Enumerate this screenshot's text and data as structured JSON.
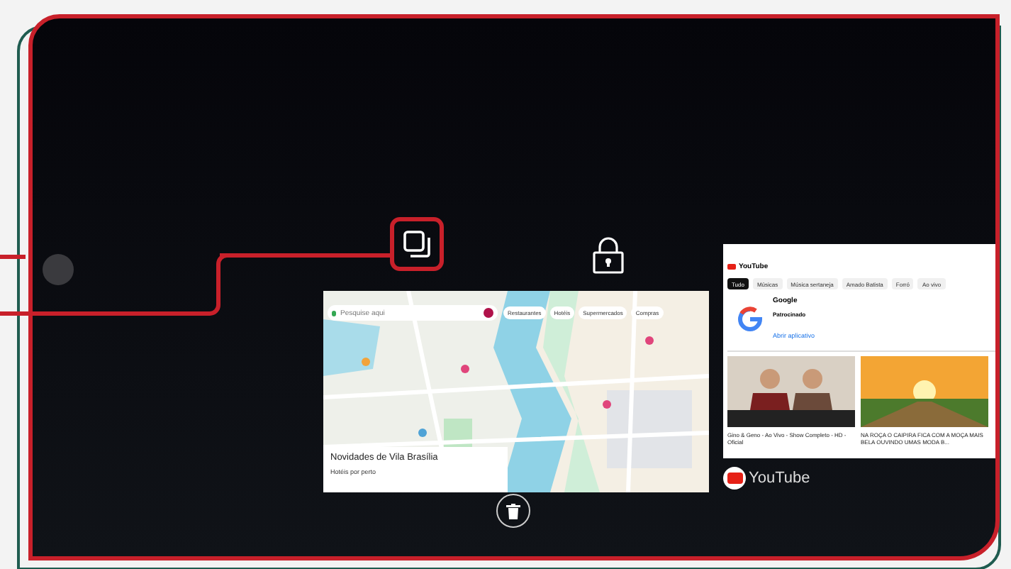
{
  "apps": [
    {
      "kind": "maps",
      "search": {
        "placeholder": "Pesquise aqui"
      },
      "chips": [
        "Restaurantes",
        "Hotéis",
        "Supermercados",
        "Compras"
      ],
      "sheet_title": "Novidades de Vila Brasília",
      "sheet_subtitle": "Hotéis por perto"
    },
    {
      "kind": "youtube",
      "label": "YouTube",
      "brand": "YouTube",
      "chips": [
        {
          "label": "Tudo",
          "selected": true
        },
        {
          "label": "Músicas",
          "selected": false
        },
        {
          "label": "Música sertaneja",
          "selected": false
        },
        {
          "label": "Amado Batista",
          "selected": false
        },
        {
          "label": "Forró",
          "selected": false
        },
        {
          "label": "Ao vivo",
          "selected": false
        }
      ],
      "ad": {
        "title": "Google",
        "tag": "Patrocinado",
        "button": "Abrir aplicativo"
      },
      "videos": [
        {
          "title": "Gino & Geno - Ao Vivo - Show Completo - HD - Oficial"
        },
        {
          "title": "NA ROÇA O CAIPIRA FICA COM A MOÇA MAIS BELA OUVINDO UMAS MODA B..."
        }
      ]
    }
  ]
}
